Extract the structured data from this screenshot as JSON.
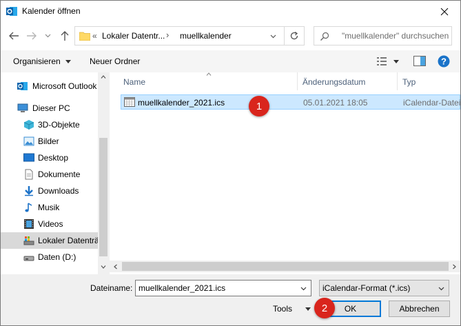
{
  "window": {
    "title": "Kalender öffnen"
  },
  "address": {
    "overflow": "«",
    "crumbs": [
      "Lokaler Datentr...",
      "muellkalender"
    ],
    "search_placeholder": "\"muellkalender\" durchsuchen"
  },
  "toolbar": {
    "organize": "Organisieren",
    "new_folder": "Neuer Ordner"
  },
  "sidebar": {
    "items": [
      {
        "label": "Microsoft Outlook",
        "icon": "outlook-icon"
      },
      {
        "label": "Dieser PC",
        "icon": "pc-icon"
      },
      {
        "label": "3D-Objekte",
        "icon": "3d-objects-icon"
      },
      {
        "label": "Bilder",
        "icon": "pictures-icon"
      },
      {
        "label": "Desktop",
        "icon": "desktop-icon"
      },
      {
        "label": "Dokumente",
        "icon": "documents-icon"
      },
      {
        "label": "Downloads",
        "icon": "downloads-icon"
      },
      {
        "label": "Musik",
        "icon": "music-icon"
      },
      {
        "label": "Videos",
        "icon": "videos-icon"
      },
      {
        "label": "Lokaler Datenträger (C:)",
        "icon": "drive-c-icon"
      },
      {
        "label": "Daten (D:)",
        "icon": "drive-d-icon"
      }
    ]
  },
  "columns": {
    "name": "Name",
    "date": "Änderungsdatum",
    "type": "Typ"
  },
  "files": [
    {
      "name": "muellkalender_2021.ics",
      "date": "05.01.2021 18:05",
      "type": "iCalendar-Datei"
    }
  ],
  "bottom": {
    "filename_label": "Dateiname:",
    "filename_value": "muellkalender_2021.ics",
    "filter": "iCalendar-Format (*.ics)",
    "tools": "Tools",
    "ok": "OK",
    "cancel": "Abbrechen"
  },
  "annotations": {
    "badge1": "1",
    "badge2": "2"
  },
  "colors": {
    "accent": "#0078d7",
    "selection": "#cce8ff",
    "badge": "#d9251d"
  }
}
